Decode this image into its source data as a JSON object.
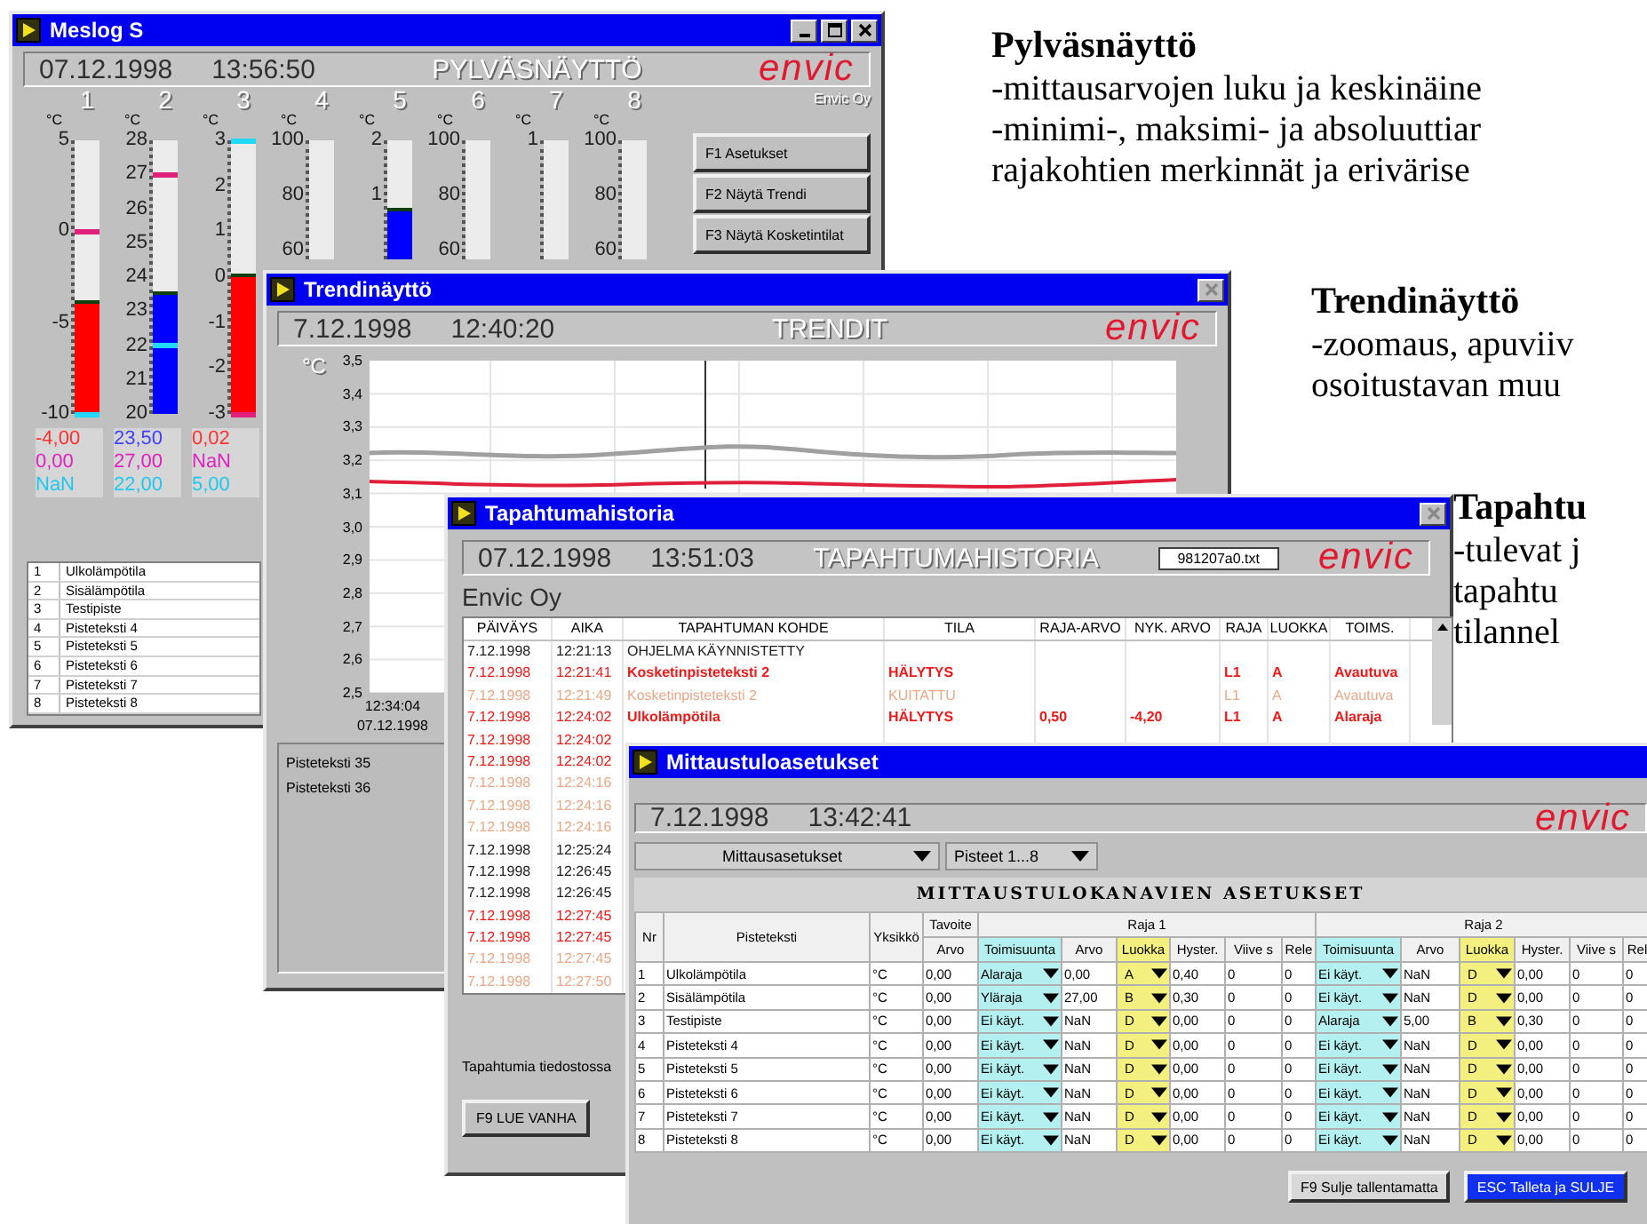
{
  "bar_window": {
    "title": "Meslog S",
    "date": "07.12.1998",
    "time": "13:56:50",
    "view_title": "PYLVÄSNÄYTTÖ",
    "logo": "envic",
    "company": "Envic Oy",
    "gauges": [
      {
        "number": "1",
        "unit": "°C",
        "kind": "full",
        "ticks": [
          "5",
          "0",
          "-5",
          "-10"
        ],
        "level": 0.4,
        "color": "#ff0000",
        "markers": [
          {
            "level": 0.667,
            "color": "#e0207a"
          },
          {
            "level": 0,
            "color": "#20d8f8"
          }
        ],
        "readings": [
          {
            "text": "-4,00",
            "color": "#ff3030"
          },
          {
            "text": "0,00",
            "color": "#e020c0"
          },
          {
            "text": "NaN",
            "color": "#20c8f0"
          }
        ]
      },
      {
        "number": "2",
        "unit": "°C",
        "kind": "full",
        "ticks": [
          "28",
          "27",
          "26",
          "25",
          "24",
          "23",
          "22",
          "21",
          "20"
        ],
        "level": 0.4375,
        "color": "#0000ff",
        "markers": [
          {
            "level": 0.875,
            "color": "#e0207a"
          },
          {
            "level": 0.25,
            "color": "#20d8f8"
          }
        ],
        "readings": [
          {
            "text": "23,50",
            "color": "#4040ff"
          },
          {
            "text": "27,00",
            "color": "#e020c0"
          },
          {
            "text": "22,00",
            "color": "#20c8f0"
          }
        ]
      },
      {
        "number": "3",
        "unit": "°C",
        "kind": "full",
        "ticks": [
          "3",
          "2",
          "1",
          "0",
          "-1",
          "-2",
          "-3"
        ],
        "level": 0.503,
        "color": "#ff0000",
        "markers": [
          {
            "level": 1,
            "color": "#20d8f8"
          },
          {
            "level": 0,
            "color": "#e0207a"
          }
        ],
        "readings": [
          {
            "text": "0,02",
            "color": "#ff3030"
          },
          {
            "text": "NaN",
            "color": "#e020c0"
          },
          {
            "text": "5,00",
            "color": "#20c8f0"
          }
        ]
      },
      {
        "number": "4",
        "unit": "°C",
        "kind": "cut",
        "ticks": [
          "100",
          "80",
          "60"
        ]
      },
      {
        "number": "5",
        "unit": "°C",
        "kind": "cut",
        "ticks": [
          "2",
          "1"
        ],
        "level": 0.4,
        "color": "#0000ff"
      },
      {
        "number": "6",
        "unit": "°C",
        "kind": "cut",
        "ticks": [
          "100",
          "80",
          "60"
        ]
      },
      {
        "number": "7",
        "unit": "°C",
        "kind": "cut",
        "ticks": [
          "1"
        ]
      },
      {
        "number": "8",
        "unit": "°C",
        "kind": "cut",
        "ticks": [
          "100",
          "80",
          "60"
        ]
      }
    ],
    "buttons": [
      "F1  Asetukset",
      "F2  Näytä Trendi",
      "F3  Näytä Kosketintilat"
    ],
    "channels": [
      {
        "number": "1",
        "name": "Ulkolämpötila"
      },
      {
        "number": "2",
        "name": "Sisälämpötila"
      },
      {
        "number": "3",
        "name": "Testipiste"
      },
      {
        "number": "4",
        "name": "Pisteteksti 4"
      },
      {
        "number": "5",
        "name": "Pisteteksti 5"
      },
      {
        "number": "6",
        "name": "Pisteteksti 6"
      },
      {
        "number": "7",
        "name": "Pisteteksti 7"
      },
      {
        "number": "8",
        "name": "Pisteteksti 8"
      }
    ]
  },
  "trend_window": {
    "title": "Trendinäyttö",
    "date": "7.12.1998",
    "time": "12:40:20",
    "view_title": "TRENDIT",
    "logo": "envic",
    "unit": "°C",
    "y_ticks": [
      "3,5",
      "3,4",
      "3,3",
      "3,2",
      "3,1",
      "3,0",
      "2,9",
      "2,8",
      "2,7",
      "2,6",
      "2,5"
    ],
    "x_time": "12:34:04",
    "x_date": "07.12.1998",
    "legend": [
      "Pisteteksti 35",
      "Pisteteksti 36"
    ]
  },
  "event_window": {
    "title": "Tapahtumahistoria",
    "date": "07.12.1998",
    "time": "13:51:03",
    "view_title": "TAPAHTUMAHISTORIA",
    "file": "981207a0.txt",
    "logo": "envic",
    "company": "Envic Oy",
    "columns": [
      "PÄIVÄYS",
      "AIKA",
      "TAPAHTUMAN KOHDE",
      "TILA",
      "RAJA-ARVO",
      "NYK. ARVO",
      "RAJA",
      "LUOKKA",
      "TOIMS."
    ],
    "rows": [
      {
        "kind": "info",
        "date": "7.12.1998",
        "time": "12:21:13",
        "target": "OHJELMA KÄYNNISTETTY"
      },
      {
        "kind": "alarm",
        "date": "7.12.1998",
        "time": "12:21:41",
        "target": "Kosketinpisteteksti 2",
        "state": "HÄLYTYS",
        "limit": "L1",
        "class": "A",
        "action": "Avautuva"
      },
      {
        "kind": "ack",
        "date": "7.12.1998",
        "time": "12:21:49",
        "target": "Kosketinpisteteksti 2",
        "state": "KUITATTU",
        "limit": "L1",
        "class": "A",
        "action": "Avautuva"
      },
      {
        "kind": "alarm",
        "date": "7.12.1998",
        "time": "12:24:02",
        "target": "Ulkolämpötila",
        "state": "HÄLYTYS",
        "limit_value": "0,50",
        "current_value": "-4,20",
        "limit": "L1",
        "class": "A",
        "action": "Alaraja"
      },
      {
        "kind": "alarm",
        "date": "7.12.1998",
        "time": "12:24:02"
      },
      {
        "kind": "alarm",
        "date": "7.12.1998",
        "time": "12:24:02"
      },
      {
        "kind": "ack",
        "date": "7.12.1998",
        "time": "12:24:16"
      },
      {
        "kind": "ack",
        "date": "7.12.1998",
        "time": "12:24:16"
      },
      {
        "kind": "ack",
        "date": "7.12.1998",
        "time": "12:24:16"
      },
      {
        "kind": "info",
        "date": "7.12.1998",
        "time": "12:25:24"
      },
      {
        "kind": "info",
        "date": "7.12.1998",
        "time": "12:26:45"
      },
      {
        "kind": "info",
        "date": "7.12.1998",
        "time": "12:26:45"
      },
      {
        "kind": "alarm",
        "date": "7.12.1998",
        "time": "12:27:45"
      },
      {
        "kind": "alarm",
        "date": "7.12.1998",
        "time": "12:27:45"
      },
      {
        "kind": "ack",
        "date": "7.12.1998",
        "time": "12:27:45"
      },
      {
        "kind": "ack",
        "date": "7.12.1998",
        "time": "12:27:50"
      }
    ],
    "footer": "Tapahtumia tiedostossa",
    "button": "F9 LUE VANHA"
  },
  "settings_window": {
    "title": "Mittaustuloasetukset",
    "date": "7.12.1998",
    "time": "13:42:41",
    "logo": "envic",
    "selectors": [
      "Mittausasetukset",
      "Pisteet 1...8"
    ],
    "heading": "MITTAUSTULOKANAVIEN ASETUKSET",
    "columns": {
      "nr": "Nr",
      "name": "Pisteteksti",
      "unit": "Yksikkö",
      "target": [
        "Tavoite",
        "Arvo"
      ]
    },
    "groups": [
      {
        "label": "Raja 1",
        "subheads": [
          {
            "label": "Toimisuunta",
            "kind": "direction"
          },
          {
            "label": "Arvo",
            "kind": "plain"
          },
          {
            "label": "Luokka",
            "kind": "class"
          },
          {
            "label": "Hyster.",
            "kind": "plain"
          },
          {
            "label": "Viive s",
            "kind": "plain"
          },
          {
            "label": "Rele",
            "kind": "plain"
          }
        ]
      },
      {
        "label": "Raja 2",
        "subheads": [
          {
            "label": "Toimisuunta",
            "kind": "direction"
          },
          {
            "label": "Arvo",
            "kind": "plain"
          },
          {
            "label": "Luokka",
            "kind": "class"
          },
          {
            "label": "Hyster.",
            "kind": "plain"
          },
          {
            "label": "Viive s",
            "kind": "plain"
          },
          {
            "label": "Rel",
            "kind": "plain"
          }
        ]
      }
    ],
    "rows": [
      {
        "nr": "1",
        "name": "Ulkolämpötila",
        "unit": "°C",
        "target": "0,00",
        "limits": [
          [
            "Alaraja",
            "0,00",
            "A",
            "0,40",
            "0",
            "0"
          ],
          [
            "Ei käyt.",
            "NaN",
            "D",
            "0,00",
            "0",
            "0"
          ]
        ]
      },
      {
        "nr": "2",
        "name": "Sisälämpötila",
        "unit": "°C",
        "target": "0,00",
        "limits": [
          [
            "Yläraja",
            "27,00",
            "B",
            "0,30",
            "0",
            "0"
          ],
          [
            "Ei käyt.",
            "NaN",
            "D",
            "0,00",
            "0",
            "0"
          ]
        ]
      },
      {
        "nr": "3",
        "name": "Testipiste",
        "unit": "°C",
        "target": "0,00",
        "limits": [
          [
            "Ei käyt.",
            "NaN",
            "D",
            "0,00",
            "0",
            "0"
          ],
          [
            "Alaraja",
            "5,00",
            "B",
            "0,30",
            "0",
            "0"
          ]
        ]
      },
      {
        "nr": "4",
        "name": "Pisteteksti 4",
        "unit": "°C",
        "target": "0,00",
        "limits": [
          [
            "Ei käyt.",
            "NaN",
            "D",
            "0,00",
            "0",
            "0"
          ],
          [
            "Ei käyt.",
            "NaN",
            "D",
            "0,00",
            "0",
            "0"
          ]
        ]
      },
      {
        "nr": "5",
        "name": "Pisteteksti 5",
        "unit": "°C",
        "target": "0,00",
        "limits": [
          [
            "Ei käyt.",
            "NaN",
            "D",
            "0,00",
            "0",
            "0"
          ],
          [
            "Ei käyt.",
            "NaN",
            "D",
            "0,00",
            "0",
            "0"
          ]
        ]
      },
      {
        "nr": "6",
        "name": "Pisteteksti 6",
        "unit": "°C",
        "target": "0,00",
        "limits": [
          [
            "Ei käyt.",
            "NaN",
            "D",
            "0,00",
            "0",
            "0"
          ],
          [
            "Ei käyt.",
            "NaN",
            "D",
            "0,00",
            "0",
            "0"
          ]
        ]
      },
      {
        "nr": "7",
        "name": "Pisteteksti 7",
        "unit": "°C",
        "target": "0,00",
        "limits": [
          [
            "Ei käyt.",
            "NaN",
            "D",
            "0,00",
            "0",
            "0"
          ],
          [
            "Ei käyt.",
            "NaN",
            "D",
            "0,00",
            "0",
            "0"
          ]
        ]
      },
      {
        "nr": "8",
        "name": "Pisteteksti 8",
        "unit": "°C",
        "target": "0,00",
        "limits": [
          [
            "Ei käyt.",
            "NaN",
            "D",
            "0,00",
            "0",
            "0"
          ],
          [
            "Ei käyt.",
            "NaN",
            "D",
            "0,00",
            "0",
            "0"
          ]
        ]
      }
    ],
    "buttons": [
      {
        "label": "F9 Sulje tallentamatta",
        "kind": "normal"
      },
      {
        "label": "ESC Talleta ja SULJE",
        "kind": "default"
      }
    ]
  },
  "notes": [
    {
      "heading": "Pylväsnäyttö",
      "lines": [
        "-mittausarvojen luku ja keskinäine",
        "-minimi-, maksimi- ja absoluuttiar",
        "rajakohtien merkinnät ja erivärise"
      ]
    },
    {
      "heading": "Trendinäyttö",
      "lines": [
        "-zoomaus, apuviiv",
        "osoitustavan muu"
      ]
    },
    {
      "heading": "Tapahtu",
      "lines": [
        "-tulevat j",
        "tapahtu",
        "tilannel"
      ]
    }
  ]
}
